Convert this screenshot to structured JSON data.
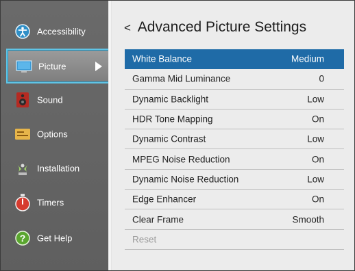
{
  "sidebar": {
    "items": [
      {
        "label": "Accessibility",
        "icon": "accessibility-icon"
      },
      {
        "label": "Picture",
        "icon": "picture-icon"
      },
      {
        "label": "Sound",
        "icon": "speaker-icon"
      },
      {
        "label": "Options",
        "icon": "options-icon"
      },
      {
        "label": "Installation",
        "icon": "satellite-dish-icon"
      },
      {
        "label": "Timers",
        "icon": "stopwatch-icon"
      },
      {
        "label": "Get Help",
        "icon": "help-icon"
      }
    ],
    "selected_index": 1
  },
  "main": {
    "title": "Advanced Picture Settings",
    "back_glyph": "<",
    "rows": [
      {
        "name": "White Balance",
        "value": "Medium"
      },
      {
        "name": "Gamma Mid Luminance",
        "value": "0"
      },
      {
        "name": "Dynamic Backlight",
        "value": "Low"
      },
      {
        "name": "HDR Tone Mapping",
        "value": "On"
      },
      {
        "name": "Dynamic Contrast",
        "value": "Low"
      },
      {
        "name": "MPEG Noise Reduction",
        "value": "On"
      },
      {
        "name": "Dynamic Noise Reduction",
        "value": "Low"
      },
      {
        "name": "Edge Enhancer",
        "value": "On"
      },
      {
        "name": "Clear Frame",
        "value": "Smooth"
      },
      {
        "name": "Reset",
        "value": ""
      }
    ]
  },
  "colors": {
    "highlight": "#1f6ba7",
    "selection_border": "#5fc4e6",
    "sidebar_bg": "#666666",
    "main_bg": "#ececec"
  }
}
